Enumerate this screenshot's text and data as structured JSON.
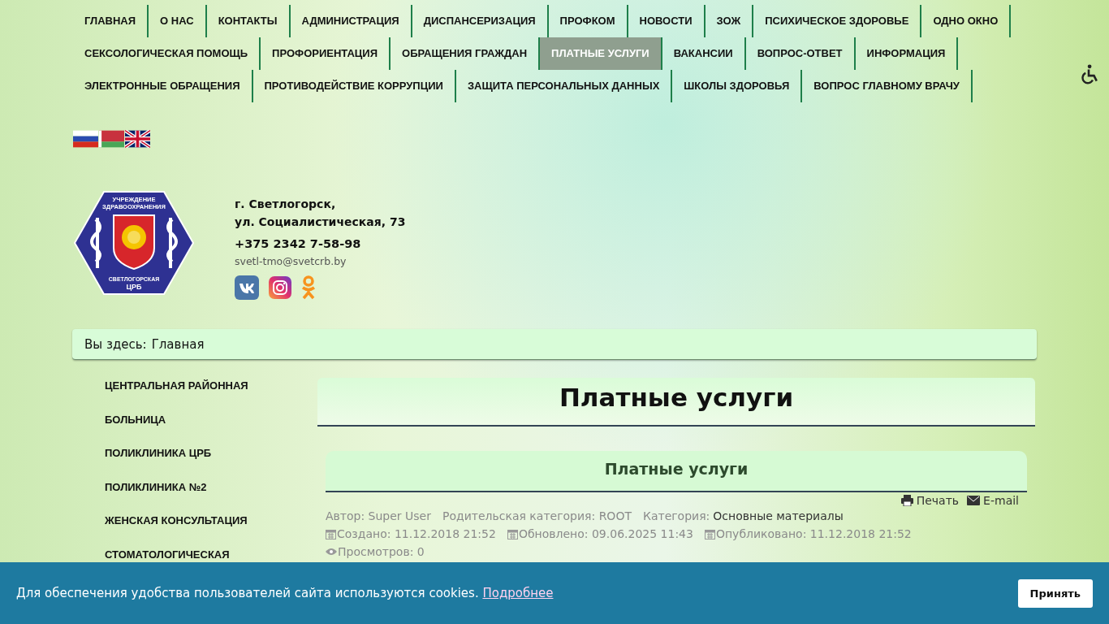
{
  "nav": {
    "items": [
      {
        "label": "ГЛАВНАЯ",
        "selected": false
      },
      {
        "label": "О НАС",
        "selected": false
      },
      {
        "label": "КОНТАКТЫ",
        "selected": false
      },
      {
        "label": "АДМИНИСТРАЦИЯ",
        "selected": false
      },
      {
        "label": "ДИСПАНСЕРИЗАЦИЯ",
        "selected": false
      },
      {
        "label": "ПРОФКОМ",
        "selected": false
      },
      {
        "label": "НОВОСТИ",
        "selected": false
      },
      {
        "label": "ЗОЖ",
        "selected": false
      },
      {
        "label": "ПСИХИЧЕСКОЕ ЗДОРОВЬЕ",
        "selected": false
      },
      {
        "label": "ОДНО ОКНО",
        "selected": false
      },
      {
        "label": "СЕКСОЛОГИЧЕСКАЯ ПОМОЩЬ",
        "selected": false
      },
      {
        "label": "ПРОФОРИЕНТАЦИЯ",
        "selected": false
      },
      {
        "label": "ОБРАЩЕНИЯ ГРАЖДАН",
        "selected": false
      },
      {
        "label": "ПЛАТНЫЕ УСЛУГИ",
        "selected": true
      },
      {
        "label": "ВАКАНСИИ",
        "selected": false
      },
      {
        "label": "ВОПРОС-ОТВЕТ",
        "selected": false
      },
      {
        "label": "ИНФОРМАЦИЯ",
        "selected": false
      },
      {
        "label": "ЭЛЕКТРОННЫЕ ОБРАЩЕНИЯ",
        "selected": false
      },
      {
        "label": "ПРОТИВОДЕЙСТВИЕ КОРРУПЦИИ",
        "selected": false
      },
      {
        "label": "ЗАЩИТА ПЕРСОНАЛЬНЫХ ДАННЫХ",
        "selected": false
      },
      {
        "label": "ШКОЛЫ ЗДОРОВЬЯ",
        "selected": false
      },
      {
        "label": "ВОПРОС ГЛАВНОМУ ВРАЧУ",
        "selected": false
      }
    ]
  },
  "logo": {
    "top": [
      "УЧРЕЖДЕНИЕ",
      "ЗДРАВООХРАНЕНИЯ"
    ],
    "bottom": [
      "СВЕТЛОГОРСКАЯ",
      "ЦРБ"
    ]
  },
  "contact": {
    "address": [
      "г. Светлогорск,",
      "ул. Социалистическая, 73"
    ],
    "phone": "+375 2342 7-58-98",
    "email": "svetl-tmo@svetcrb.by"
  },
  "breadcrumb": {
    "label": "Вы здесь:",
    "current": "Главная"
  },
  "sidebar": {
    "items": [
      "ЦЕНТРАЛЬНАЯ РАЙОННАЯ",
      "БОЛЬНИЦА",
      "ПОЛИКЛИНИКА ЦРБ",
      "ПОЛИКЛИНИКА №2",
      "ЖЕНСКАЯ КОНСУЛЬТАЦИЯ",
      "СТОМАТОЛОГИЧЕСКАЯ"
    ]
  },
  "page_title": "Платные услуги",
  "article": {
    "title": "Платные услуги",
    "actions": [
      {
        "kind": "print",
        "label": "Печать"
      },
      {
        "kind": "email",
        "label": "E-mail"
      }
    ],
    "author": "Автор: Super User",
    "parent_category": "Родительская категория: ROOT",
    "category_label": "Категория:",
    "category": "Основные материалы",
    "dates": [
      "Создано: 11.12.2018 21:52",
      "Обновлено: 09.06.2025 11:43",
      "Опубликовано: 11.12.2018 21:52"
    ],
    "hits": "Просмотров: 0"
  },
  "cookie": {
    "text": "Для обеспечения удобства пользователей сайта используются cookies.",
    "link": "Подробнее",
    "button": "Принять"
  }
}
